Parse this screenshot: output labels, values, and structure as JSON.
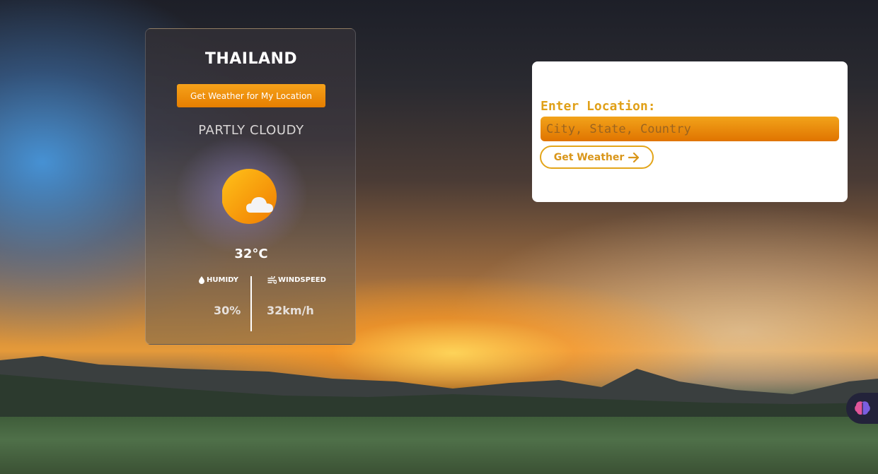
{
  "weather": {
    "country": "THAILAND",
    "location_button": "Get Weather for My Location",
    "condition": "PARTLY CLOUDY",
    "temperature": "32°C",
    "humidity_label": "HUMIDY",
    "humidity_value": "30%",
    "wind_label": "WINDSPEED",
    "wind_value": "32km/h",
    "icon": "partly-cloudy-icon"
  },
  "search": {
    "label": "Enter Location:",
    "placeholder": "City, State, Country",
    "button": "Get Weather"
  },
  "colors": {
    "accent": "#f39a10",
    "panel_text": "#e0a018"
  }
}
